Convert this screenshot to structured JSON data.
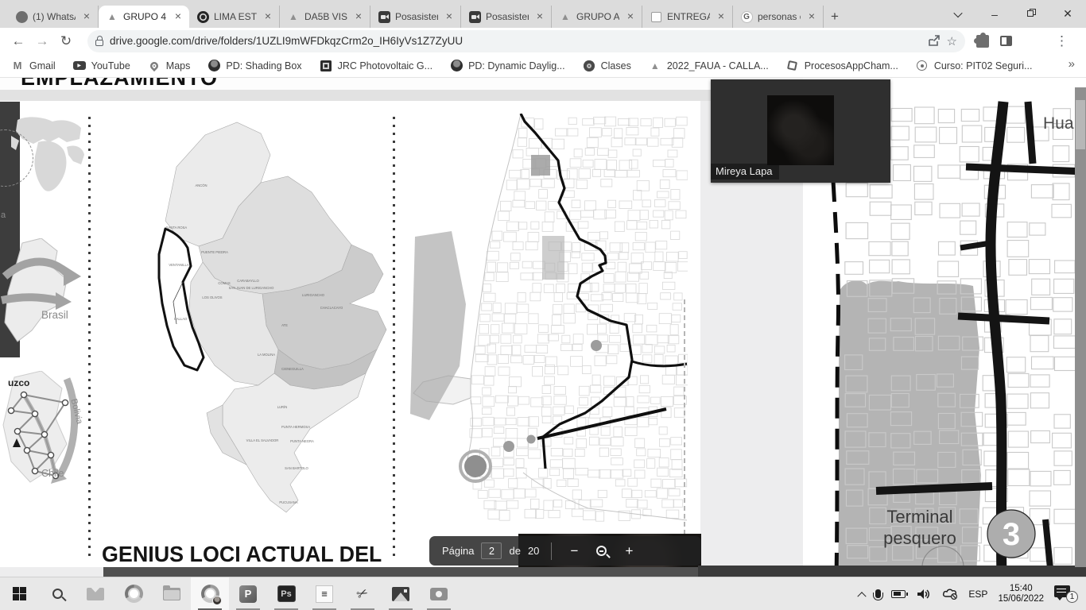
{
  "icons": {
    "back": "←",
    "forward": "→",
    "reload": "↻",
    "star": "☆",
    "menu": "⋮",
    "overflow": "»",
    "scissors": "✂",
    "drive_triangle": "▲",
    "google_g": "G",
    "gmail_m": "M",
    "youtube_play": "▶",
    "close": "×",
    "new_tab": "+",
    "minimize": "–",
    "window_close": "✕",
    "minus": "−",
    "plus": "+",
    "sketchup": "≡"
  },
  "chrome": {
    "tabs": [
      {
        "label": "(1) WhatsA",
        "icon": "whatsapp"
      },
      {
        "label": "GRUPO 4 -",
        "icon": "drive",
        "active": true
      },
      {
        "label": "LIMA ESTE",
        "icon": "site"
      },
      {
        "label": "DA5B VISI",
        "icon": "drive"
      },
      {
        "label": "Posasisten",
        "icon": "meet"
      },
      {
        "label": "Posasisten",
        "icon": "meet"
      },
      {
        "label": "GRUPO AV",
        "icon": "drive"
      },
      {
        "label": "ENTREGA",
        "icon": "doc"
      },
      {
        "label": "personas c",
        "icon": "google"
      }
    ],
    "url": "drive.google.com/drive/folders/1UZLI9mWFDkqzCrm2o_IH6IyVs1Z7ZyUU",
    "bookmarks": [
      {
        "label": "Gmail"
      },
      {
        "label": "YouTube"
      },
      {
        "label": "Maps"
      },
      {
        "label": "PD: Shading Box"
      },
      {
        "label": "JRC Photovoltaic G..."
      },
      {
        "label": "PD: Dynamic Daylig..."
      },
      {
        "label": "Clases"
      },
      {
        "label": "2022_FAUA - CALLA..."
      },
      {
        "label": "ProcesosAppCham..."
      },
      {
        "label": "Curso: PIT02 Seguri..."
      }
    ]
  },
  "doc": {
    "heading_top": "EMPLAZAMIENTO",
    "heading_bottom": "GENIUS LOCI ACTUAL DEL SITIO",
    "page1": {
      "label_a": "a",
      "brasil": "Brasil",
      "cuzco": "uzco",
      "bolivia": "Bolivia",
      "chile": "Chile"
    },
    "lima_labels": [
      "ANCÓN",
      "SANTA ROSA",
      "CARABAYLLO",
      "VENTANILLA",
      "PUENTE PIEDRA",
      "COMAS",
      "LOS OLIVOS",
      "SAN JUAN DE LURIGANCHO",
      "LURIGANCHO",
      "CHACLACAYO",
      "CALLAO",
      "ATE",
      "LA MOLINA",
      "CIENEGUILLA",
      "VILLA EL SALVADOR",
      "LURÍN",
      "PUNTA HERMOSA",
      "PUNTA NEGRA",
      "SAN BARTOLO",
      "PUCUSANA"
    ]
  },
  "viewer": {
    "page_word": "Página",
    "current_page": "2",
    "of_word": "de",
    "total_pages": "20"
  },
  "meeting": {
    "participant_name": "Mireya Lapa"
  },
  "shared_map": {
    "hua_label": "Hua",
    "terminal_line1": "Terminal",
    "terminal_line2": "pesquero",
    "marker_number": "3"
  },
  "tray": {
    "language": "ESP",
    "time": "15:40",
    "date": "15/06/2022",
    "notification_count": "1"
  }
}
